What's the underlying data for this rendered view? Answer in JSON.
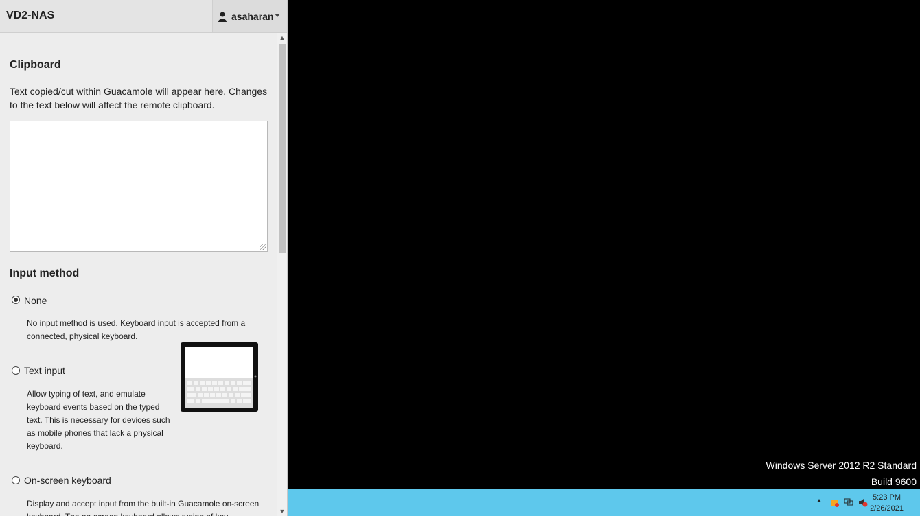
{
  "menu": {
    "title": "VD2-NAS",
    "username": "asaharan"
  },
  "clipboard": {
    "heading": "Clipboard",
    "description": "Text copied/cut within Guacamole will appear here. Changes to the text below will affect the remote clipboard.",
    "value": ""
  },
  "input_method": {
    "heading": "Input method",
    "selected": "None",
    "options": [
      {
        "label": "None",
        "description": "No input method is used. Keyboard input is accepted from a connected, physical keyboard."
      },
      {
        "label": "Text input",
        "description": "Allow typing of text, and emulate keyboard events based on the typed text. This is necessary for devices such as mobile phones that lack a physical keyboard."
      },
      {
        "label": "On-screen keyboard",
        "description": "Display and accept input from the built-in Guacamole on-screen keyboard. The on-screen keyboard allows typing of key"
      }
    ]
  },
  "remote": {
    "os_name": "Windows Server 2012 R2 Standard",
    "build": "Build 9600",
    "clock_time": "5:23 PM",
    "clock_date": "2/26/2021"
  },
  "colors": {
    "taskbar": "#5ec8ec",
    "menu_bg": "#ededed",
    "remote_bg": "#000000"
  },
  "icons": [
    "user-icon",
    "chevron-down-icon",
    "resize-grip-icon",
    "tray-arrow-icon",
    "network-icon",
    "flag-icon",
    "volume-mute-icon",
    "tablet-keyboard-illustration"
  ]
}
